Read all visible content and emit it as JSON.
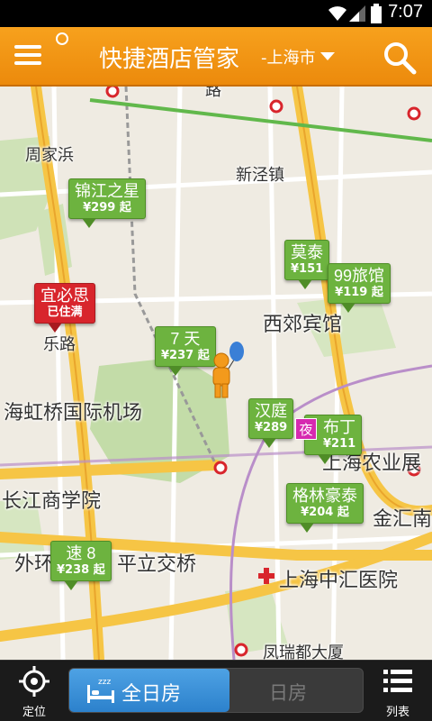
{
  "statusbar": {
    "time": "7:07"
  },
  "header": {
    "title": "快捷酒店管家",
    "city": "-上海市"
  },
  "map": {
    "labels": {
      "road_top": "路",
      "zhoujiabang": "周家浜",
      "xinjingzhen": "新泾镇",
      "xijiao": "西郊宾馆",
      "airport": "海虹桥国际机场",
      "business_school": "长江商学院",
      "agri": "上海农业展",
      "jinhui": "金汇南",
      "waihuan": "外环",
      "pingli": "平立交桥",
      "hospital": "上海中汇医院",
      "lelu": "乐路",
      "bottom": "凤瑞都大厦"
    },
    "hotels": [
      {
        "name": "锦江之星",
        "price": "¥299 起"
      },
      {
        "name": "宜必思",
        "price": "已住满"
      },
      {
        "name": "莫泰",
        "price": "¥151"
      },
      {
        "name": "99旅馆",
        "price": "¥119 起"
      },
      {
        "name": "7 天",
        "price": "¥237 起"
      },
      {
        "name": "汉庭",
        "price": "¥289"
      },
      {
        "name": "布丁",
        "price": "¥211"
      },
      {
        "name": "格林豪泰",
        "price": "¥204 起"
      },
      {
        "name": "速 8",
        "price": "¥238 起"
      }
    ],
    "night_badge": "夜"
  },
  "bottombar": {
    "locate_label": "定位",
    "tab_all_day": "全日房",
    "tab_day": "日房",
    "list_label": "列表"
  },
  "colors": {
    "header": "#f0900f",
    "pin_green": "#6db33f",
    "pin_full": "#d8252c",
    "tab_active": "#3a8fd8",
    "night": "#d62ab0"
  }
}
